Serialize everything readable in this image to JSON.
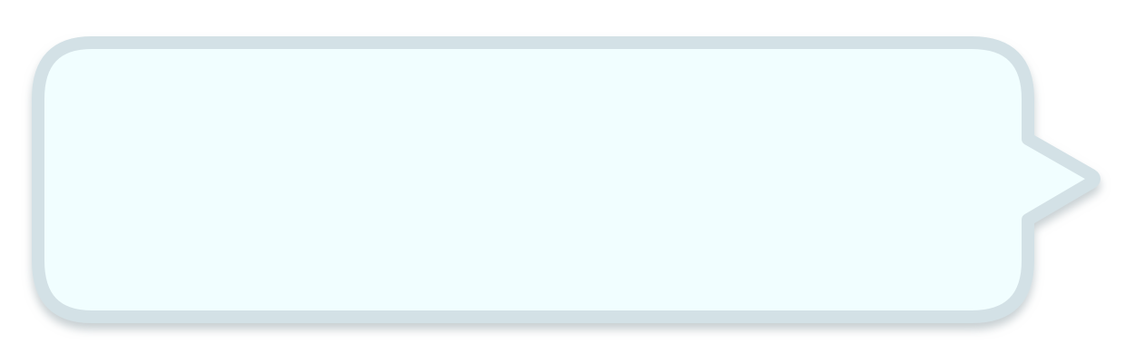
{
  "bubble": {
    "text": "",
    "fill_color": "#F1FEFF",
    "border_color": "#D3E1E6",
    "shadow_color": "#9AA8AD",
    "tail_direction": "right"
  }
}
